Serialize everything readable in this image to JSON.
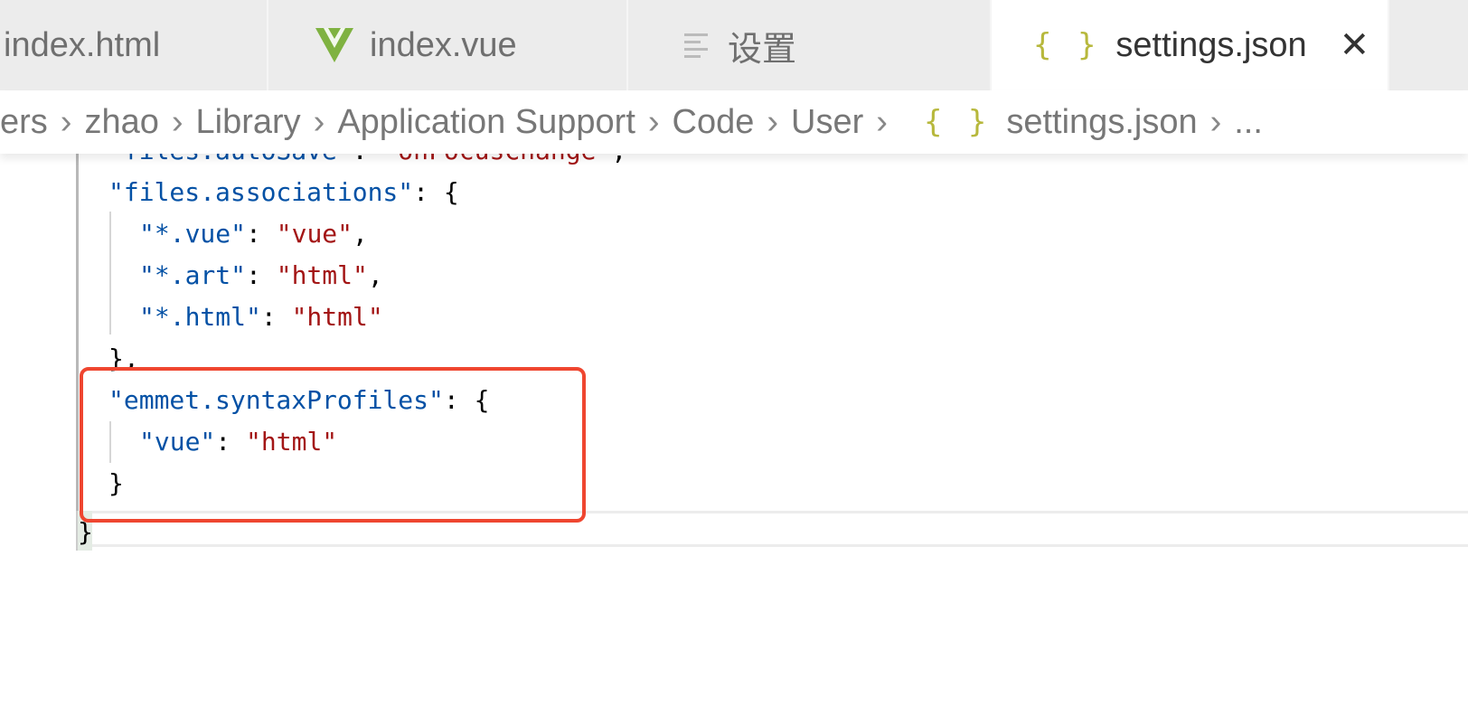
{
  "tabs": [
    {
      "label": "index.html",
      "icon": "html-file-icon"
    },
    {
      "label": "index.vue",
      "icon": "vue-logo-icon"
    },
    {
      "label": "设置",
      "icon": "settings-lines-icon"
    },
    {
      "label": "settings.json",
      "icon": "json-braces-icon",
      "active": true,
      "close": "✕"
    }
  ],
  "breadcrumb": {
    "items": [
      "ers",
      "zhao",
      "Library",
      "Application Support",
      "Code",
      "User",
      "settings.json",
      "..."
    ],
    "braces": "{ }",
    "separator": "›"
  },
  "editor": {
    "lines": [
      {
        "key": "\"files.autoSave\"",
        "punct": ": ",
        "value": "\"onFocusChange\"",
        "end": ","
      },
      {
        "key": "\"files.associations\"",
        "punct": ": {",
        "value": "",
        "end": ""
      },
      {
        "key": "\"*.vue\"",
        "punct": ": ",
        "value": "\"vue\"",
        "end": ","
      },
      {
        "key": "\"*.art\"",
        "punct": ": ",
        "value": "\"html\"",
        "end": ","
      },
      {
        "key": "\"*.html\"",
        "punct": ": ",
        "value": "\"html\"",
        "end": ""
      },
      {
        "key": "",
        "punct": "},",
        "value": "",
        "end": ""
      },
      {
        "key": "\"emmet.syntaxProfiles\"",
        "punct": ": {",
        "value": "",
        "end": ""
      },
      {
        "key": "\"vue\"",
        "punct": ": ",
        "value": "\"html\"",
        "end": ""
      },
      {
        "key": "",
        "punct": "}",
        "value": "",
        "end": ""
      },
      {
        "key": "",
        "punct": "}",
        "value": "",
        "end": ""
      }
    ]
  },
  "colors": {
    "key": "#0451a5",
    "string": "#a31515",
    "highlight_box": "#ef4630",
    "json_icon": "#b7b83c",
    "vue_icon": "#7fb241"
  }
}
